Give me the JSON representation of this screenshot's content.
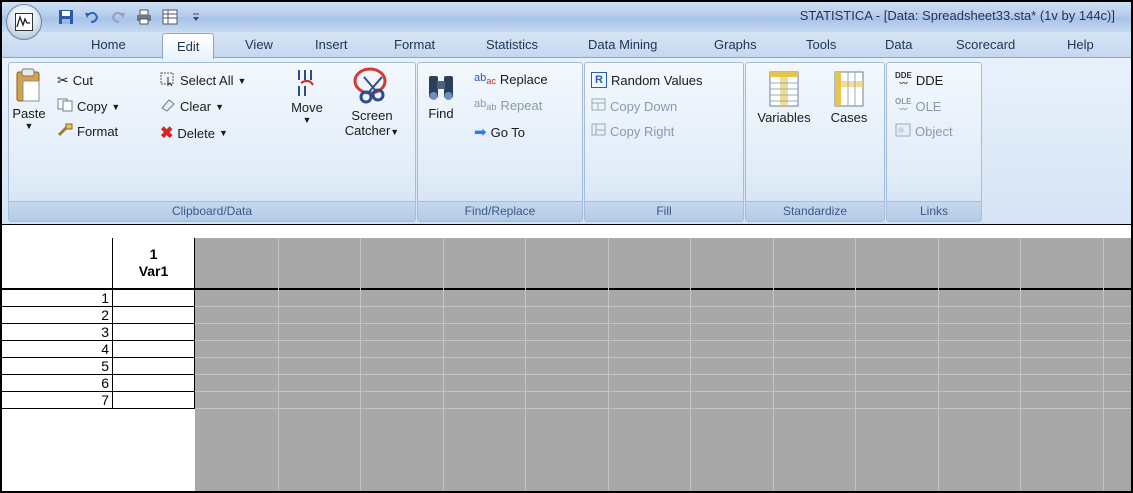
{
  "window": {
    "title": "STATISTICA - [Data: Spreadsheet33.sta* (1v by 144c)]"
  },
  "quick_access": {
    "icons": [
      "save-icon",
      "undo-icon",
      "redo-icon",
      "print-icon",
      "spreadsheet-icon",
      "customize-icon"
    ]
  },
  "tabs": [
    {
      "label": "Home"
    },
    {
      "label": "Edit",
      "active": true
    },
    {
      "label": "View"
    },
    {
      "label": "Insert"
    },
    {
      "label": "Format"
    },
    {
      "label": "Statistics"
    },
    {
      "label": "Data Mining"
    },
    {
      "label": "Graphs"
    },
    {
      "label": "Tools"
    },
    {
      "label": "Data"
    },
    {
      "label": "Scorecard"
    },
    {
      "label": "Help"
    }
  ],
  "ribbon": {
    "clipboard": {
      "label": "Clipboard/Data",
      "paste": "Paste",
      "cut": "Cut",
      "copy": "Copy",
      "format": "Format",
      "select_all": "Select All",
      "clear": "Clear",
      "delete": "Delete",
      "move": "Move",
      "screen": "Screen",
      "catcher": "Catcher"
    },
    "find": {
      "label": "Find/Replace",
      "find": "Find",
      "replace": "Replace",
      "repeat": "Repeat",
      "goto": "Go To"
    },
    "fill": {
      "label": "Fill",
      "random": "Random Values",
      "copy_down": "Copy Down",
      "copy_right": "Copy Right"
    },
    "standardize": {
      "label": "Standardize",
      "variables": "Variables",
      "cases": "Cases"
    },
    "links": {
      "label": "Links",
      "dde": "DDE",
      "ole": "OLE",
      "object": "Object"
    }
  },
  "spreadsheet": {
    "column": {
      "number": "1",
      "name": "Var1"
    },
    "rows": [
      "1",
      "2",
      "3",
      "4",
      "5",
      "6",
      "7"
    ],
    "empty_columns": 11
  },
  "colors": {
    "grid_gray": "#a8a8a8",
    "ribbon_blue": "#d5e4f5"
  }
}
